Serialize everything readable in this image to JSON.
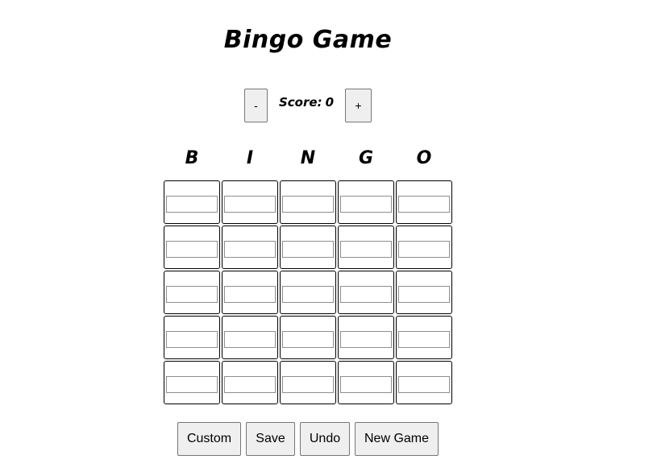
{
  "title": "Bingo Game",
  "score": {
    "label": "Score:",
    "value": "0",
    "decrement_label": "-",
    "increment_label": "+"
  },
  "board": {
    "letters": [
      "B",
      "I",
      "N",
      "G",
      "O"
    ],
    "rows": 5,
    "columns": 5,
    "cells": [
      [
        "",
        "",
        "",
        "",
        ""
      ],
      [
        "",
        "",
        "",
        "",
        ""
      ],
      [
        "",
        "",
        "",
        "",
        ""
      ],
      [
        "",
        "",
        "",
        "",
        ""
      ],
      [
        "",
        "",
        "",
        "",
        ""
      ]
    ]
  },
  "actions": {
    "custom_label": "Custom",
    "save_label": "Save",
    "undo_label": "Undo",
    "new_game_label": "New Game"
  }
}
